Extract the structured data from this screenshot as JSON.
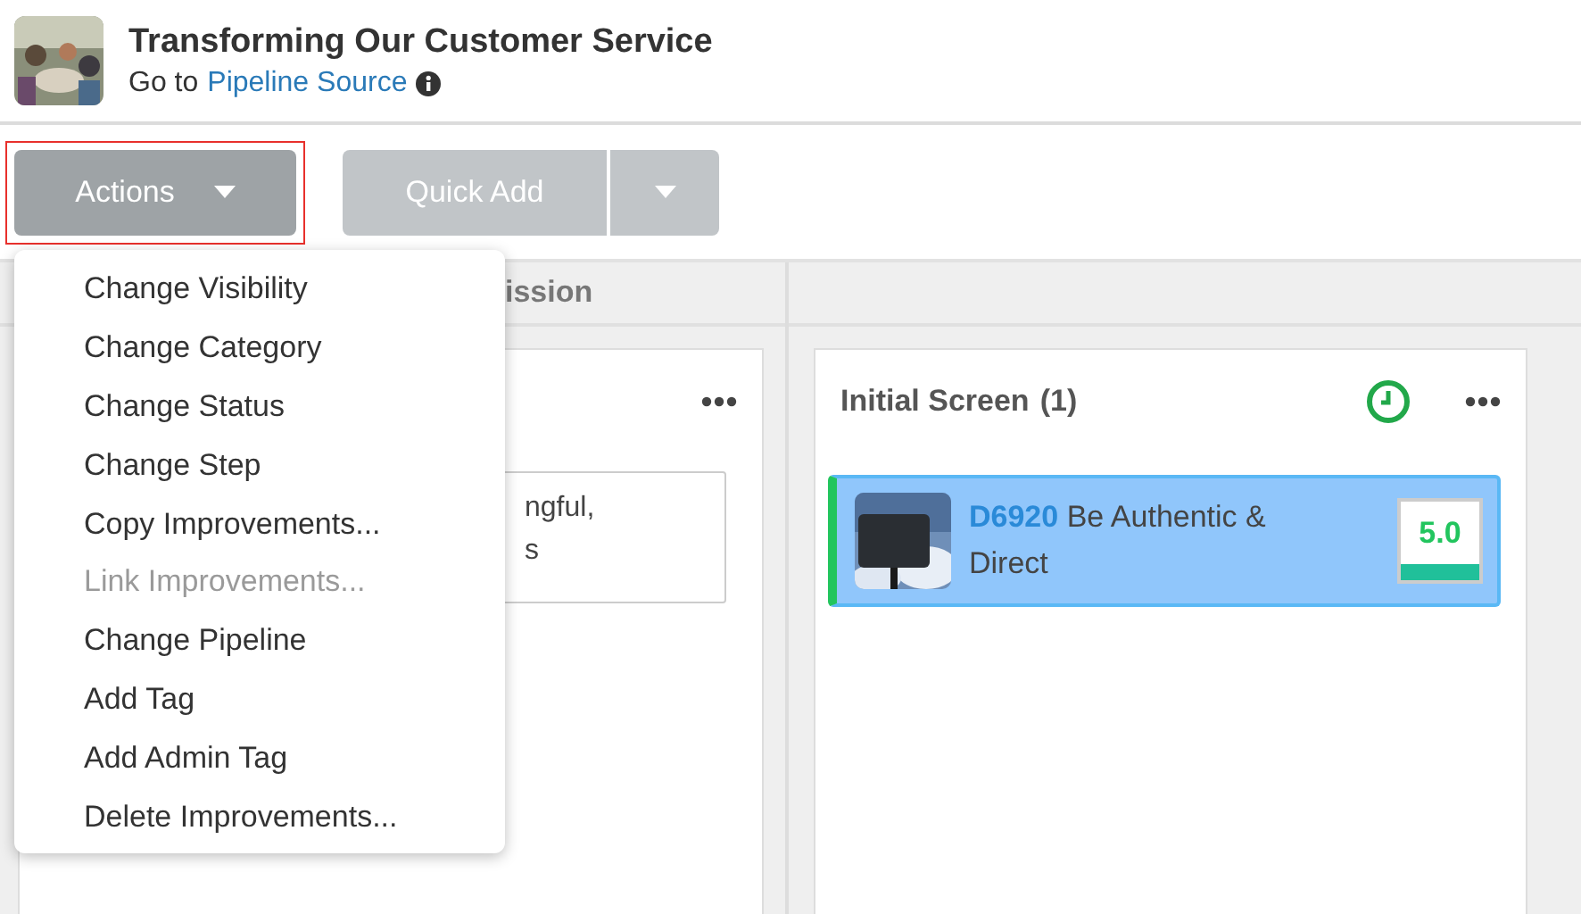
{
  "header": {
    "title": "Transforming Our Customer Service",
    "goto_prefix": "Go to",
    "goto_link": "Pipeline Source"
  },
  "toolbar": {
    "actions_button": "Actions",
    "actions_focused": true,
    "quick_add_button": "Quick Add"
  },
  "actions_menu": {
    "items": [
      {
        "label": "Change Visibility",
        "disabled": false
      },
      {
        "label": "Change Category",
        "disabled": false
      },
      {
        "label": "Change Status",
        "disabled": false
      },
      {
        "label": "Change Step",
        "disabled": false
      },
      {
        "label": "Copy Improvements...",
        "disabled": false
      },
      {
        "label": "Link Improvements...",
        "disabled": true
      },
      {
        "label": "Change Pipeline",
        "disabled": false
      },
      {
        "label": "Add Tag",
        "disabled": false
      },
      {
        "label": "Add Admin Tag",
        "disabled": false
      },
      {
        "label": "Delete Improvements...",
        "disabled": false
      }
    ]
  },
  "columns": [
    {
      "header": "ission",
      "panel": {
        "item_lines": [
          "ngful,",
          "s"
        ]
      }
    },
    {
      "panel": {
        "title": "Initial Screen",
        "count": "(1)",
        "cards": [
          {
            "id": "D6920",
            "title": "Be Authentic & Direct",
            "score": "5.0",
            "selected": true
          }
        ]
      }
    }
  ]
}
